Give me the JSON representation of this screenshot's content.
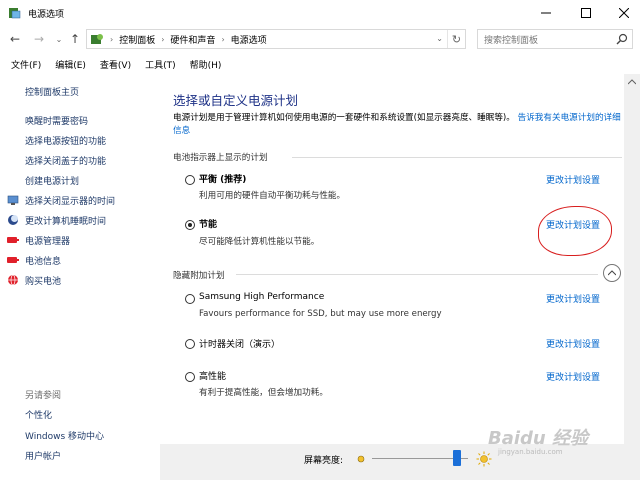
{
  "window": {
    "title": "电源选项"
  },
  "address": {
    "crumbs": [
      "控制面板",
      "硬件和声音",
      "电源选项"
    ],
    "search_placeholder": "搜索控制面板"
  },
  "menu": [
    "文件(F)",
    "编辑(E)",
    "查看(V)",
    "工具(T)",
    "帮助(H)"
  ],
  "sidebar": {
    "home": "控制面板主页",
    "links": [
      "唤醒时需要密码",
      "选择电源按钮的功能",
      "选择关闭盖子的功能",
      "创建电源计划",
      "选择关闭显示器的时间",
      "更改计算机睡眠时间",
      "电源管理器",
      "电池信息",
      "购买电池"
    ],
    "see_also": "另请参阅",
    "see_also_links": [
      "个性化",
      "Windows 移动中心",
      "用户帐户"
    ]
  },
  "main": {
    "heading": "选择或自定义电源计划",
    "desc_text": "电源计划是用于管理计算机如何使用电源的一套硬件和系统设置(如显示器亮度、睡眠等)。",
    "desc_link": "告诉我有关电源计划的详细信息",
    "section_battery": "电池指示器上显示的计划",
    "section_hidden": "隐藏附加计划",
    "change_label": "更改计划设置",
    "plans": [
      {
        "name": "平衡 (推荐)",
        "desc": "利用可用的硬件自动平衡功耗与性能。",
        "selected": false
      },
      {
        "name": "节能",
        "desc": "尽可能降低计算机性能以节能。",
        "selected": true
      },
      {
        "name": "Samsung High Performance",
        "desc": "Favours performance for SSD, but may use more energy",
        "selected": false
      },
      {
        "name": "计时器关闭（演示）",
        "desc": "",
        "selected": false
      },
      {
        "name": "高性能",
        "desc": "有利于提高性能，但会增加功耗。",
        "selected": false
      }
    ]
  },
  "bottom": {
    "brightness_label": "屏幕亮度:",
    "brightness_level": 0.92
  },
  "watermark": {
    "brand": "Baidu 经验",
    "url": "jingyan.baidu.com"
  },
  "colors": {
    "heading": "#1e3287",
    "link": "#0066cc",
    "annotation": "#d81e1e"
  }
}
